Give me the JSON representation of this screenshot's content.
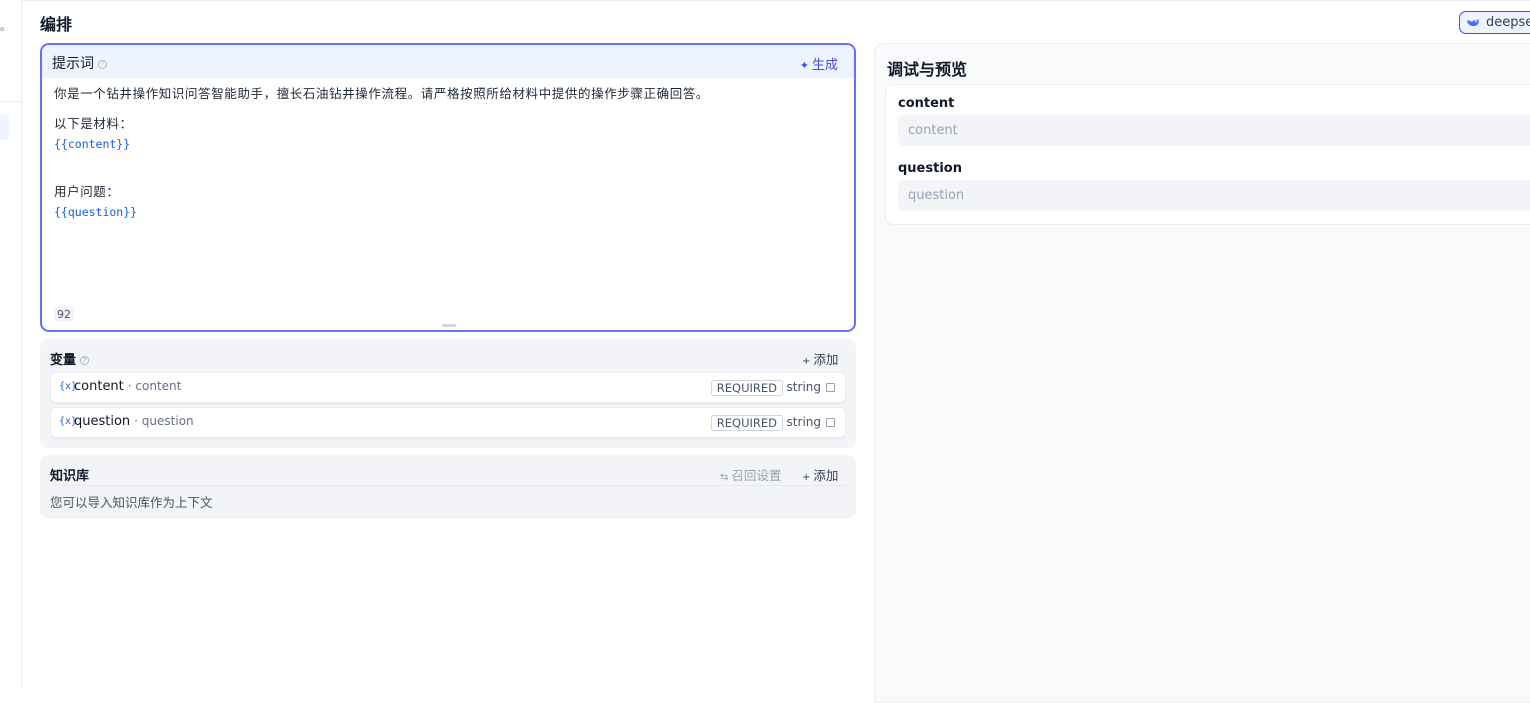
{
  "sidebar": {
    "fragment": "。"
  },
  "header": {
    "title": "编排",
    "model_name": "deepseek"
  },
  "prompt": {
    "title": "提示词",
    "generate_label": "生成",
    "line1": "你是一个钻井操作知识问答智能助手，擅长石油钻井操作流程。请严格按照所给材料中提供的操作步骤正确回答。",
    "line2": "以下是材料：",
    "var1": "{{content}}",
    "line3": "用户问题：",
    "var2": "{{question}}",
    "char_count": "92"
  },
  "variables": {
    "title": "变量",
    "add_label": "添加",
    "items": [
      {
        "icon": "{x}",
        "name": "content",
        "label": "· content",
        "required": "REQUIRED",
        "type": "string"
      },
      {
        "icon": "{x}",
        "name": "question",
        "label": "· question",
        "required": "REQUIRED",
        "type": "string"
      }
    ]
  },
  "knowledge": {
    "title": "知识库",
    "recall_label": "召回设置",
    "add_label": "添加",
    "description": "您可以导入知识库作为上下文"
  },
  "debug": {
    "title": "调试与预览",
    "fields": [
      {
        "label": "content",
        "placeholder": "content"
      },
      {
        "label": "question",
        "placeholder": "question"
      }
    ]
  }
}
